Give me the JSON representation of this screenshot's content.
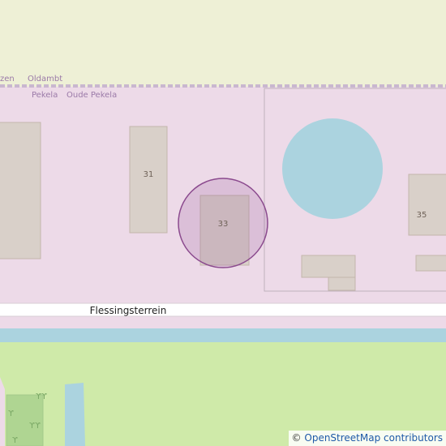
{
  "map": {
    "place_labels": [
      "Pekela",
      "Oude Pekela",
      "Oldambt",
      "zen"
    ],
    "street_label": "Flessingsterrein",
    "house_numbers": [
      "31",
      "33",
      "35"
    ],
    "highlighted_house": "33",
    "colors": {
      "industrial": "#eddae8",
      "farmland": "#eef0d6",
      "grass": "#cfeaa9",
      "water": "#abd3df",
      "building": "#d9d0c9",
      "building_border": "#c4b6ab",
      "highlight": "#8b4a8e",
      "road": "#ffffff"
    }
  },
  "attribution": {
    "copyright_symbol": "©",
    "text": "OpenStreetMap contributors"
  }
}
